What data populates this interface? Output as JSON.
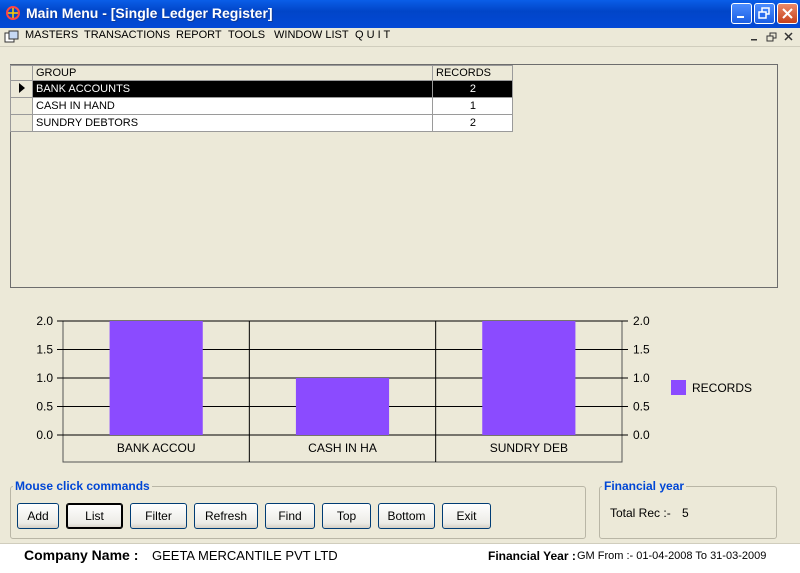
{
  "window": {
    "title": "Main Menu - [Single Ledger Register]"
  },
  "menu": [
    {
      "label": "MASTERS"
    },
    {
      "label": "TRANSACTIONS"
    },
    {
      "label": "REPORT"
    },
    {
      "label": "TOOLS"
    },
    {
      "label": "WINDOW LIST"
    },
    {
      "label": "Q U I T"
    }
  ],
  "grid": {
    "columns": [
      "GROUP",
      "RECORDS"
    ],
    "rows": [
      {
        "group": "BANK ACCOUNTS",
        "records": "2",
        "active": true
      },
      {
        "group": "CASH IN HAND",
        "records": "1",
        "active": false
      },
      {
        "group": "SUNDRY DEBTORS",
        "records": "2",
        "active": false
      }
    ]
  },
  "chart_data": {
    "type": "bar",
    "categories": [
      "BANK ACCOU",
      "CASH IN HA",
      "SUNDRY DEB"
    ],
    "series": [
      {
        "name": "RECORDS",
        "values": [
          2,
          1,
          2
        ],
        "color": "#8B4BFF"
      }
    ],
    "ylim": [
      0,
      2
    ],
    "yticks": [
      "0.0",
      "0.5",
      "1.0",
      "1.5",
      "2.0"
    ],
    "grid": true,
    "dual_y_axis": true,
    "legend_position": "right"
  },
  "commands": {
    "title": "Mouse click commands",
    "buttons": [
      {
        "label": "Add"
      },
      {
        "label": "List"
      },
      {
        "label": "Filter"
      },
      {
        "label": "Refresh"
      },
      {
        "label": "Find"
      },
      {
        "label": "Top"
      },
      {
        "label": "Bottom"
      },
      {
        "label": "Exit"
      }
    ]
  },
  "financial": {
    "title": "Financial year",
    "total_label": "Total Rec :-",
    "total_value": "5"
  },
  "status": {
    "company_label": "Company Name :",
    "company_value": "GEETA MERCANTILE PVT LTD",
    "fy_label": "Financial Year :",
    "fy_value": "GM From :- 01-04-2008 To 31-03-2009"
  }
}
